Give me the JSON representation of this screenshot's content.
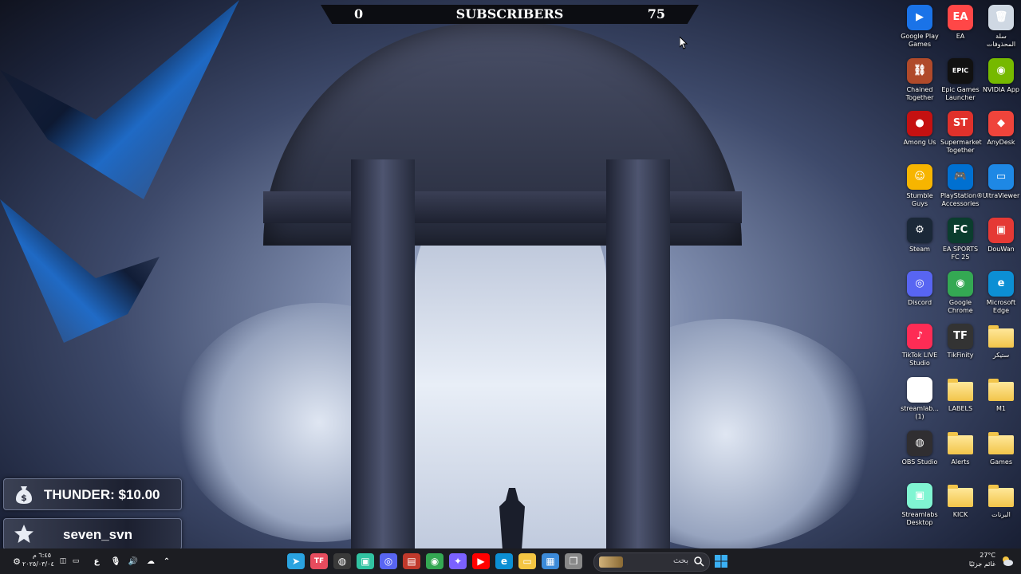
{
  "subscriber_bar": {
    "start": "0",
    "title": "SUBSCRIBERS",
    "end": "75",
    "progress_percent": 0
  },
  "desktop_icons": [
    {
      "label": "Google Play Games",
      "icon": "google-play-games-icon",
      "color": "#1a73e8",
      "glyph": "▶"
    },
    {
      "label": "EA",
      "icon": "ea-icon",
      "color": "#ff4747",
      "glyph": "EA"
    },
    {
      "label": "سلة المحذوفات",
      "icon": "recycle-bin-icon",
      "color": "#cfd8e3",
      "glyph": "🗑"
    },
    {
      "label": "Chained Together",
      "icon": "chained-together-icon",
      "color": "#b04a2a",
      "glyph": "⛓"
    },
    {
      "label": "Epic Games Launcher",
      "icon": "epic-games-icon",
      "color": "#111111",
      "glyph": "EPIC"
    },
    {
      "label": "NVIDIA App",
      "icon": "nvidia-icon",
      "color": "#76b900",
      "glyph": "◉"
    },
    {
      "label": "Among Us",
      "icon": "among-us-icon",
      "color": "#c51111",
      "glyph": "●"
    },
    {
      "label": "Supermarket Together",
      "icon": "supermarket-together-icon",
      "color": "#e0312b",
      "glyph": "ST"
    },
    {
      "label": "AnyDesk",
      "icon": "anydesk-icon",
      "color": "#ef443b",
      "glyph": "◆"
    },
    {
      "label": "Stumble Guys",
      "icon": "stumble-guys-icon",
      "color": "#f7b500",
      "glyph": "☺"
    },
    {
      "label": "PlayStation® Accessories",
      "icon": "playstation-accessories-icon",
      "color": "#0070d1",
      "glyph": "🎮"
    },
    {
      "label": "UltraViewer",
      "icon": "ultraviewer-icon",
      "color": "#1e88e5",
      "glyph": "▭"
    },
    {
      "label": "Steam",
      "icon": "steam-icon",
      "color": "#1b2838",
      "glyph": "⚙"
    },
    {
      "label": "EA SPORTS FC 25",
      "icon": "ea-sports-fc25-icon",
      "color": "#0b3d2e",
      "glyph": "FC"
    },
    {
      "label": "DouWan",
      "icon": "douwan-icon",
      "color": "#e53935",
      "glyph": "▣"
    },
    {
      "label": "Discord",
      "icon": "discord-icon",
      "color": "#5865f2",
      "glyph": "◎"
    },
    {
      "label": "Google Chrome",
      "icon": "chrome-icon",
      "color": "#34a853",
      "glyph": "◉"
    },
    {
      "label": "Microsoft Edge",
      "icon": "edge-icon",
      "color": "#0c8fd4",
      "glyph": "e"
    },
    {
      "label": "TikTok LIVE Studio",
      "icon": "tiktok-live-studio-icon",
      "color": "#fe2c55",
      "glyph": "♪"
    },
    {
      "label": "TikFinity",
      "icon": "tikfinity-icon",
      "color": "#333333",
      "glyph": "TF"
    },
    {
      "label": "ستيكر",
      "icon": "folder-icon",
      "color": "folder",
      "glyph": ""
    },
    {
      "label": "streamlab... (1)",
      "icon": "streamlabs-icon",
      "color": "#ffffff",
      "glyph": "▣"
    },
    {
      "label": "LABELS",
      "icon": "folder-icon",
      "color": "folder",
      "glyph": ""
    },
    {
      "label": "M1",
      "icon": "folder-icon",
      "color": "folder",
      "glyph": ""
    },
    {
      "label": "OBS Studio",
      "icon": "obs-studio-icon",
      "color": "#302e31",
      "glyph": "◍"
    },
    {
      "label": "Alerts",
      "icon": "folder-icon",
      "color": "folder",
      "glyph": ""
    },
    {
      "label": "Games",
      "icon": "folder-icon",
      "color": "folder",
      "glyph": ""
    },
    {
      "label": "Streamlabs Desktop",
      "icon": "streamlabs-desktop-icon",
      "color": "#80f5d2",
      "glyph": "▣"
    },
    {
      "label": "KICK",
      "icon": "folder-icon",
      "color": "folder",
      "glyph": ""
    },
    {
      "label": "البرنات",
      "icon": "folder-icon",
      "color": "folder",
      "glyph": ""
    }
  ],
  "alerts": {
    "donation": {
      "text": "THUNDER: $10.00",
      "icon": "money-bag-icon"
    },
    "follow": {
      "text": "seven_svn",
      "icon": "star-icon"
    }
  },
  "taskbar": {
    "apps": [
      {
        "name": "telegram",
        "glyph": "➤",
        "color": "#2aa3e0"
      },
      {
        "name": "tikfinity",
        "glyph": "TF",
        "color": "#e74c5e"
      },
      {
        "name": "obs",
        "glyph": "◍",
        "color": "#3a3a3a"
      },
      {
        "name": "streamlabs",
        "glyph": "▣",
        "color": "#31c3a2"
      },
      {
        "name": "discord",
        "glyph": "◎",
        "color": "#5865f2"
      },
      {
        "name": "media-player",
        "glyph": "▤",
        "color": "#c0392b"
      },
      {
        "name": "chrome",
        "glyph": "◉",
        "color": "#34a853"
      },
      {
        "name": "copilot",
        "glyph": "✦",
        "color": "#7b61ff"
      },
      {
        "name": "youtube",
        "glyph": "▶",
        "color": "#ff0000"
      },
      {
        "name": "edge",
        "glyph": "e",
        "color": "#0c8fd4"
      },
      {
        "name": "file-explorer",
        "glyph": "▭",
        "color": "#f4c542"
      },
      {
        "name": "store",
        "glyph": "▦",
        "color": "#3c8ad8"
      },
      {
        "name": "task-view",
        "glyph": "❐",
        "color": "#888888"
      }
    ],
    "search_text": "بحث",
    "weather_temp": "27°C",
    "weather_text": "غائم جزئيًا",
    "time": "٦:٤٥ م",
    "date": "٢٠٢٥/٠٣/٠٤",
    "lang": "ع"
  }
}
